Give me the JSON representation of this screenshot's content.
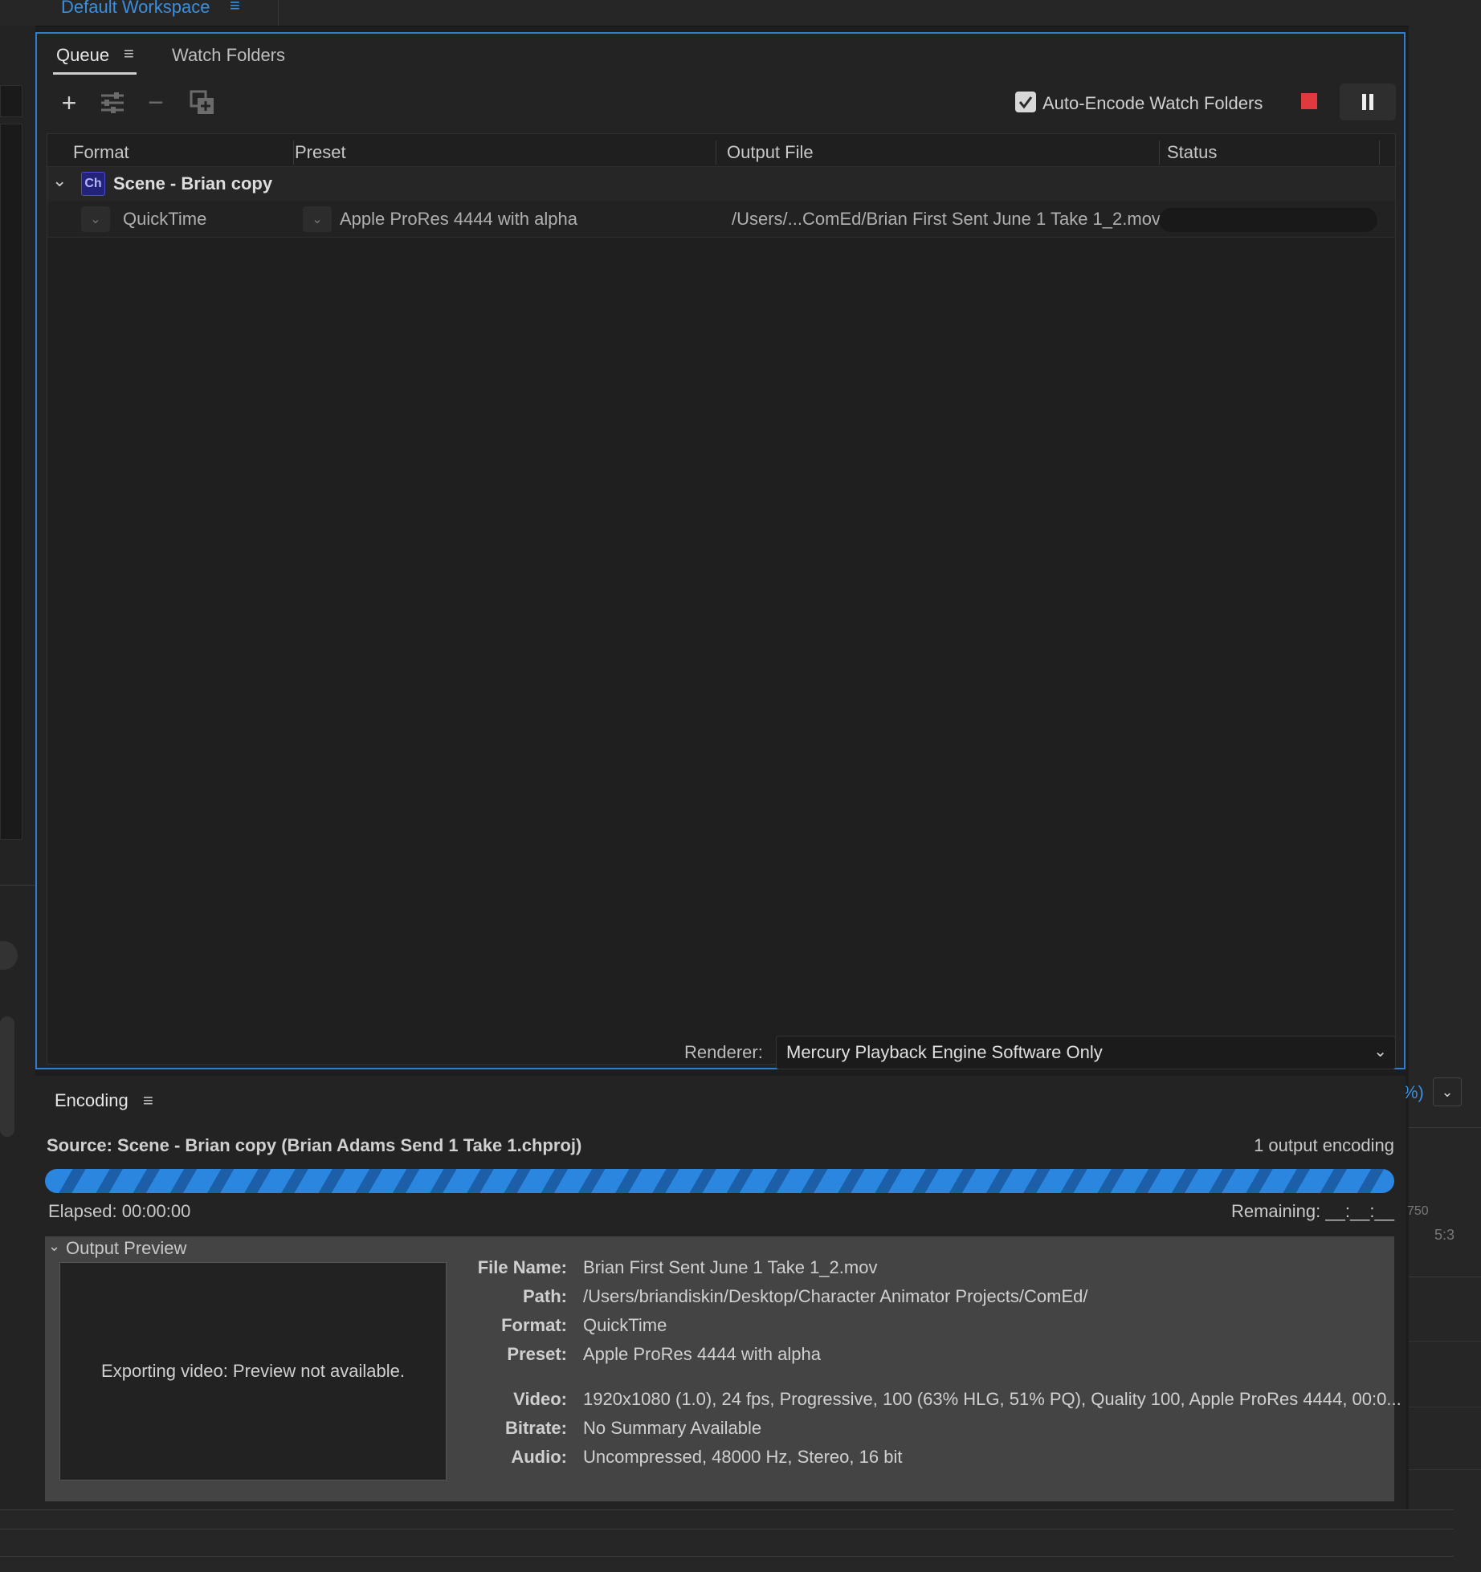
{
  "workspace": {
    "label": "Default Workspace",
    "menu_icon": "≡"
  },
  "queue": {
    "tabs": [
      {
        "label": "Queue"
      },
      {
        "label": "Watch Folders"
      }
    ],
    "menu_icon": "≡",
    "toolbar": {
      "add_icon": "+",
      "remove_icon": "−",
      "auto_encode_label": "Auto-Encode Watch Folders",
      "auto_encode_checked": true
    },
    "columns": [
      "Format",
      "Preset",
      "Output File",
      "Status"
    ],
    "group": {
      "badge": "Ch",
      "title": "Scene - Brian copy"
    },
    "item": {
      "format": "QuickTime",
      "preset": "Apple ProRes 4444 with alpha",
      "output": "/Users/...ComEd/Brian First Sent June 1 Take  1_2.mov"
    },
    "renderer": {
      "label": "Renderer:",
      "value": "Mercury Playback Engine Software Only"
    }
  },
  "encoding": {
    "tab_label": "Encoding",
    "menu_icon": "≡",
    "source": "Source: Scene - Brian copy (Brian Adams Send 1 Take 1.chproj)",
    "count": "1 output encoding",
    "elapsed": "Elapsed: 00:00:00",
    "remaining": "Remaining: __:__:__",
    "preview_header": "Output Preview",
    "preview_message": "Exporting video: Preview not available.",
    "info": {
      "file_name_label": "File Name:",
      "file_name": "Brian First Sent June 1 Take  1_2.mov",
      "path_label": "Path:",
      "path": "/Users/briandiskin/Desktop/Character Animator Projects/ComEd/",
      "format_label": "Format:",
      "format": "QuickTime",
      "preset_label": "Preset:",
      "preset": "Apple ProRes 4444 with alpha",
      "video_label": "Video:",
      "video": "1920x1080 (1.0), 24 fps, Progressive, 100 (63% HLG, 51% PQ), Quality 100, Apple ProRes 4444, 00:0...",
      "bitrate_label": "Bitrate:",
      "bitrate": "No Summary Available",
      "audio_label": "Audio:",
      "audio": "Uncompressed, 48000 Hz, Stereo, 16 bit"
    }
  },
  "side": {
    "zoom_fragment": "%)",
    "ruler_750": "750",
    "ruler_53": "5:3"
  },
  "colors": {
    "accent": "#2f7fd1",
    "stop": "#e0393e",
    "progress": "#2b86e0"
  }
}
